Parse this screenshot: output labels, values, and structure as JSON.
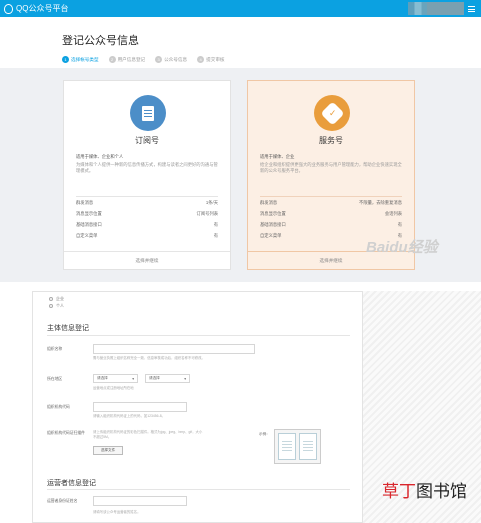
{
  "topbar": {
    "app_name": "QQ公众号平台",
    "accent": "#0ba1e1"
  },
  "page": {
    "title": "登记公众号信息"
  },
  "steps": [
    {
      "num": "1",
      "label": "选择帐号类型",
      "active": true
    },
    {
      "num": "2",
      "label": "用户信息登记",
      "active": false
    },
    {
      "num": "3",
      "label": "公众号信息",
      "active": false
    },
    {
      "num": "4",
      "label": "提交审核",
      "active": false
    }
  ],
  "cards": {
    "subscription": {
      "name": "订阅号",
      "suit": "适用于媒体、企业和个人",
      "desc": "为媒体和个人提供一种新的信息传播方式，构建与读者之间更好的沟通与管理模式。",
      "features": [
        {
          "k": "群发消息",
          "v": "1条/天"
        },
        {
          "k": "消息显示位置",
          "v": "订阅号列表"
        },
        {
          "k": "基础消息接口",
          "v": "有"
        },
        {
          "k": "自定义菜单",
          "v": "有"
        }
      ],
      "action": "选择并继续",
      "icon": "document-icon",
      "color": "#4c8ec8"
    },
    "service": {
      "name": "服务号",
      "suit": "适用于媒体、企业",
      "desc": "给企业和组织提供更强大的业务服务与用户管理能力，帮助企业快速实现全新的公众号服务平台。",
      "features": [
        {
          "k": "群发消息",
          "v": "不限量，去除重复消息"
        },
        {
          "k": "消息显示位置",
          "v": "会话列表"
        },
        {
          "k": "基础消息接口",
          "v": "有"
        },
        {
          "k": "自定义菜单",
          "v": "有"
        }
      ],
      "action": "选择并继续",
      "icon": "verified-badge-icon",
      "color": "#e99d3c"
    }
  },
  "form": {
    "radios": [
      {
        "label": "企业"
      },
      {
        "label": "个人"
      }
    ],
    "section1": "主体信息登记",
    "org_name": {
      "label": "组织名称",
      "hint": "需与营业执照上组织名称完全一致，信息审核成功后，组织名称不可修改。"
    },
    "location": {
      "label": "所在地区",
      "province": "请选择",
      "city": "请选择",
      "hint": "运营地点或注册地址所在地"
    },
    "license_no": {
      "label": "组织机构代码",
      "hint": "请输入组织机构代码证上的代码，如123456-8。"
    },
    "license_img": {
      "label": "组织机构代码证扫描件",
      "hint": "请上传组织机构代码证的彩色扫描件。格式为jpg、jpeg、bmp、gif，大小不超过5M。",
      "button": "选择文件",
      "example": "示例："
    },
    "section2": "运营者信息登记",
    "operator_id": {
      "label": "运营者身份证姓名",
      "hint": "请填写该公众号运营者的姓名。"
    }
  },
  "watermark": "Baidu经验",
  "brand": {
    "part1": "草丁",
    "part2": "图书馆"
  }
}
